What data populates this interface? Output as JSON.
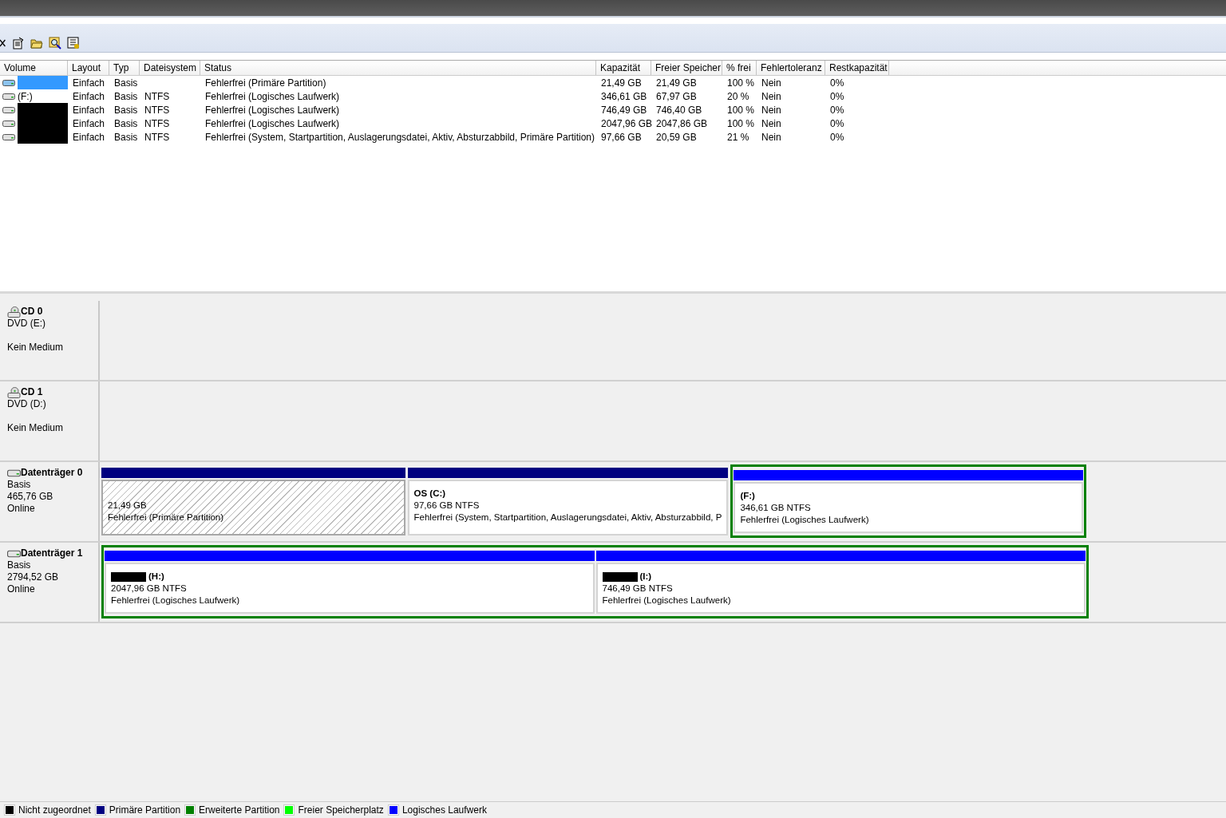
{
  "toolbar": {
    "tools": [
      {
        "kind": "close"
      },
      {
        "kind": "properties"
      },
      {
        "kind": "open"
      },
      {
        "kind": "search"
      },
      {
        "kind": "grid"
      }
    ]
  },
  "table": {
    "columns": [
      "Volume",
      "Layout",
      "Typ",
      "Dateisystem",
      "Status",
      "Kapazität",
      "Freier Speicher",
      "% frei",
      "Fehlertoleranz",
      "Restkapazität"
    ],
    "rows": [
      {
        "redacted": false,
        "selected": true,
        "cells": [
          "",
          "Einfach",
          "Basis",
          "",
          "Fehlerfrei (Primäre Partition)",
          "21,49 GB",
          "21,49 GB",
          "100 %",
          "Nein",
          "0%"
        ]
      },
      {
        "redacted": false,
        "selected": false,
        "cells": [
          "(F:)",
          "Einfach",
          "Basis",
          "NTFS",
          "Fehlerfrei (Logisches Laufwerk)",
          "346,61 GB",
          "67,97 GB",
          "20 %",
          "Nein",
          "0%"
        ]
      },
      {
        "redacted": true,
        "selected": false,
        "cells": [
          "",
          "Einfach",
          "Basis",
          "NTFS",
          "Fehlerfrei (Logisches Laufwerk)",
          "746,49 GB",
          "746,40 GB",
          "100 %",
          "Nein",
          "0%"
        ]
      },
      {
        "redacted": true,
        "selected": false,
        "cells": [
          "",
          "Einfach",
          "Basis",
          "NTFS",
          "Fehlerfrei (Logisches Laufwerk)",
          "2047,96 GB",
          "2047,86 GB",
          "100 %",
          "Nein",
          "0%"
        ]
      },
      {
        "redacted": true,
        "selected": false,
        "cells": [
          "",
          "Einfach",
          "Basis",
          "NTFS",
          "Fehlerfrei (System, Startpartition, Auslagerungsdatei, Aktiv, Absturzabbild, Primäre Partition)",
          "97,66 GB",
          "20,59 GB",
          "21 %",
          "Nein",
          "0%"
        ]
      }
    ]
  },
  "disks": [
    {
      "kind": "cd",
      "title": "CD 0",
      "lines": [
        "DVD (E:)"
      ],
      "note": "Kein Medium"
    },
    {
      "kind": "cd",
      "title": "CD 1",
      "lines": [
        "DVD (D:)"
      ],
      "note": "Kein Medium"
    },
    {
      "kind": "disk",
      "title": "Datenträger 0",
      "lines": [
        "Basis",
        "465,76 GB",
        "Online"
      ],
      "regions": [
        {
          "kind": "primary",
          "selected": true,
          "redacted": false,
          "size": "21,49 GB",
          "status": "Fehlerfrei (Primäre Partition)"
        },
        {
          "kind": "primary",
          "selected": false,
          "redacted": false,
          "name": "OS  (C:)",
          "size": "97,66 GB NTFS",
          "status": "Fehlerfrei (System, Startpartition, Auslagerungsdatei, Aktiv, Absturzabbild, P"
        },
        {
          "kind": "extended",
          "children": [
            {
              "kind": "logical",
              "selected": false,
              "redacted": false,
              "name": "(F:)",
              "size": "346,61 GB NTFS",
              "status": "Fehlerfrei (Logisches Laufwerk)"
            }
          ]
        }
      ]
    },
    {
      "kind": "disk",
      "title": "Datenträger 1",
      "lines": [
        "Basis",
        "2794,52 GB",
        "Online"
      ],
      "regions": [
        {
          "kind": "extended",
          "children": [
            {
              "kind": "logical",
              "selected": false,
              "redacted": true,
              "name": "(H:)",
              "size": "2047,96 GB NTFS",
              "status": "Fehlerfrei (Logisches Laufwerk)"
            },
            {
              "kind": "logical",
              "selected": false,
              "redacted": true,
              "name": "(I:)",
              "size": "746,49 GB NTFS",
              "status": "Fehlerfrei (Logisches Laufwerk)"
            }
          ]
        }
      ]
    }
  ],
  "legend": [
    {
      "label": "Nicht zugeordnet",
      "color": "#000000"
    },
    {
      "label": "Primäre Partition",
      "color": "#000080"
    },
    {
      "label": "Erweiterte Partition",
      "color": "#008000"
    },
    {
      "label": "Freier Speicherplatz",
      "color": "#00ff00"
    },
    {
      "label": "Logisches Laufwerk",
      "color": "#0000ff"
    }
  ]
}
